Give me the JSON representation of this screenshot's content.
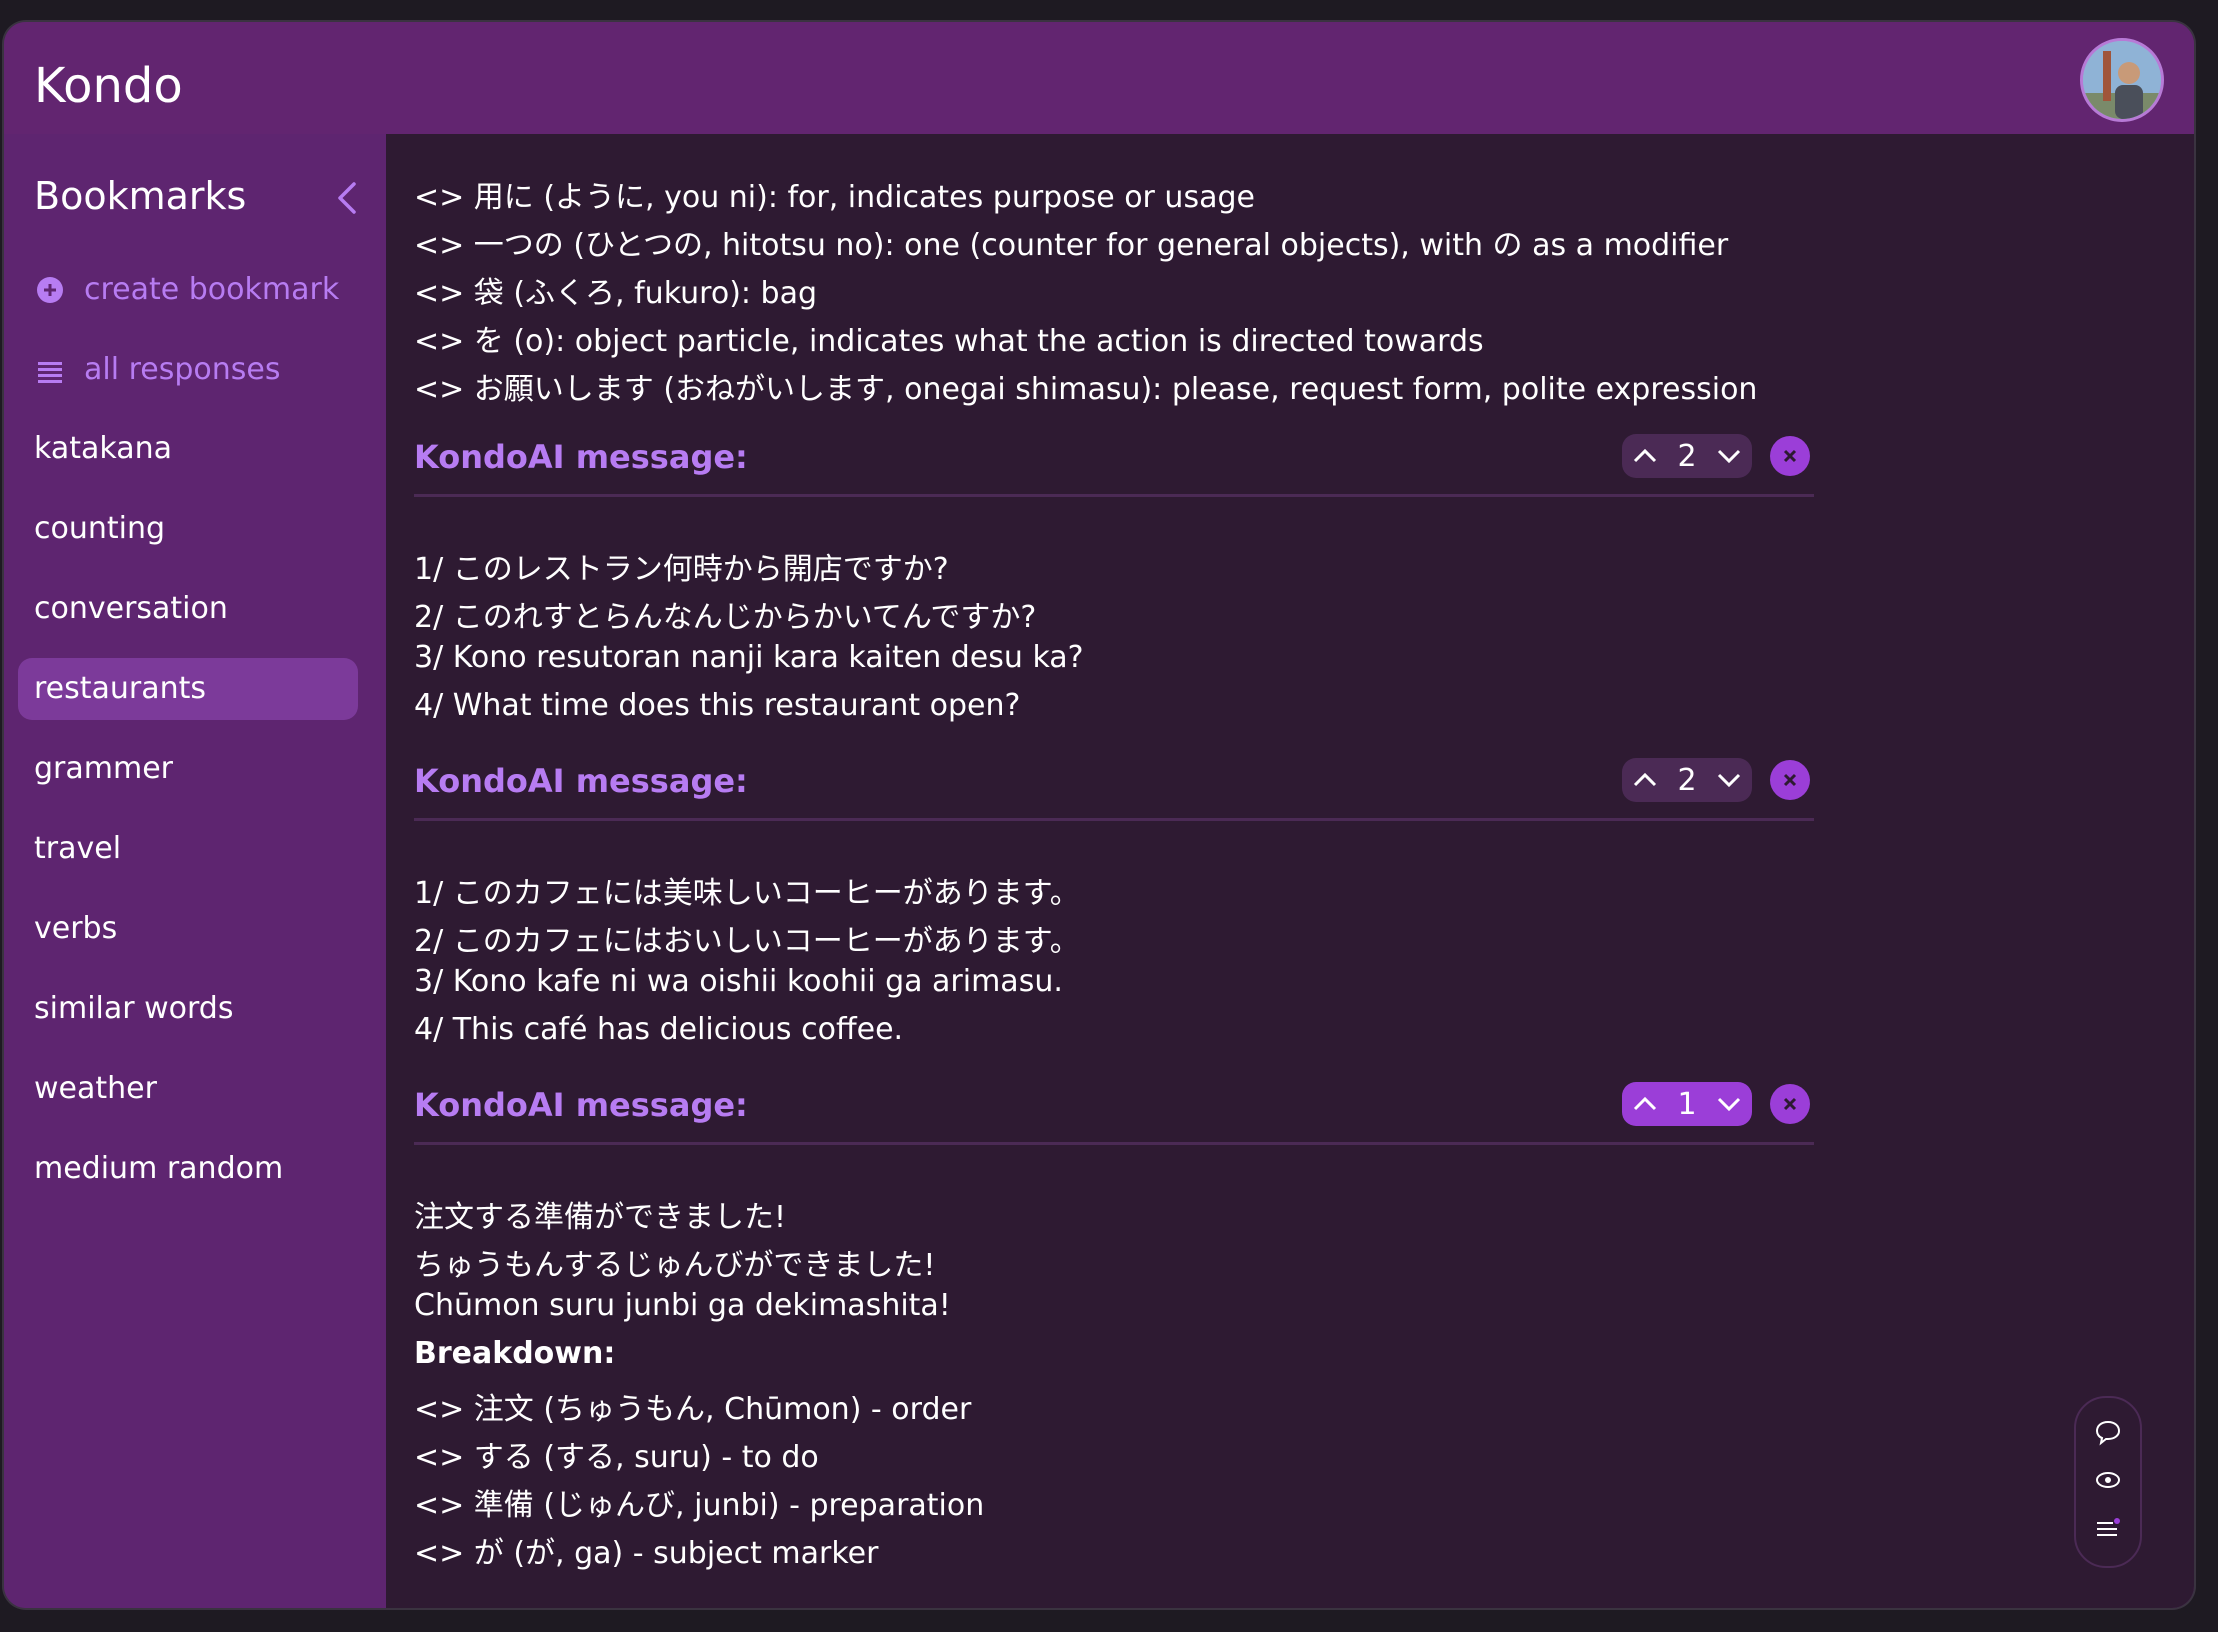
{
  "app": {
    "title": "Kondo"
  },
  "header": {
    "avatar": "user-avatar"
  },
  "sidebar": {
    "heading": "Bookmarks",
    "actions": [
      {
        "label": "create bookmark",
        "icon": "plus-circle-icon"
      },
      {
        "label": "all responses",
        "icon": "list-icon"
      }
    ],
    "items": [
      {
        "label": "katakana",
        "active": false
      },
      {
        "label": "counting",
        "active": false
      },
      {
        "label": "conversation",
        "active": false
      },
      {
        "label": "restaurants",
        "active": true
      },
      {
        "label": "grammer",
        "active": false
      },
      {
        "label": "travel",
        "active": false
      },
      {
        "label": "verbs",
        "active": false
      },
      {
        "label": "similar words",
        "active": false
      },
      {
        "label": "weather",
        "active": false
      },
      {
        "label": "medium random",
        "active": false
      }
    ]
  },
  "main": {
    "intro_lines": [
      "<> 用に (ように, you ni): for, indicates purpose or usage",
      "<> 一つの (ひとつの, hitotsu no): one (counter for general objects), with の as a modifier",
      "<> 袋 (ふくろ, fukuro): bag",
      "<> を (o): object particle, indicates what the action is directed towards",
      "<> お願いします (おねがいします, onegai shimasu): please, request form, polite expression"
    ],
    "messages": [
      {
        "title": "KondoAI message:",
        "count": "2",
        "lines": [
          "1/ このレストラン何時から開店ですか?",
          "2/ このれすとらんなんじからかいてんですか?",
          "3/ Kono resutoran nanji kara kaiten desu ka?",
          "4/ What time does this restaurant open?"
        ]
      },
      {
        "title": "KondoAI message:",
        "count": "2",
        "lines": [
          "1/ このカフェには美味しいコーヒーがあります。",
          "2/ このカフェにはおいしいコーヒーがあります。",
          "3/ Kono kafe ni wa oishii koohii ga arimasu.",
          "4/ This café has delicious coffee."
        ]
      },
      {
        "title": "KondoAI message:",
        "count": "1",
        "lines": [
          "注文する準備ができました!",
          "ちゅうもんするじゅんびができました!",
          "Chūmon suru junbi ga dekimashita!"
        ],
        "breakdown_label": "Breakdown:",
        "breakdown": [
          "<> 注文 (ちゅうもん, Chūmon) - order",
          "<> する (する, suru) - to do",
          "<> 準備 (じゅんび, junbi) - preparation",
          "<> が (が, ga) - subject marker"
        ]
      }
    ]
  },
  "tools": [
    "chat-bubble-icon",
    "eye-icon",
    "list-settings-icon"
  ],
  "colors": {
    "accent": "#b77cf2",
    "active_vote": "#9b3ed8",
    "main_bg": "#2e1a32",
    "sidebar_bg": "#5e2570"
  }
}
